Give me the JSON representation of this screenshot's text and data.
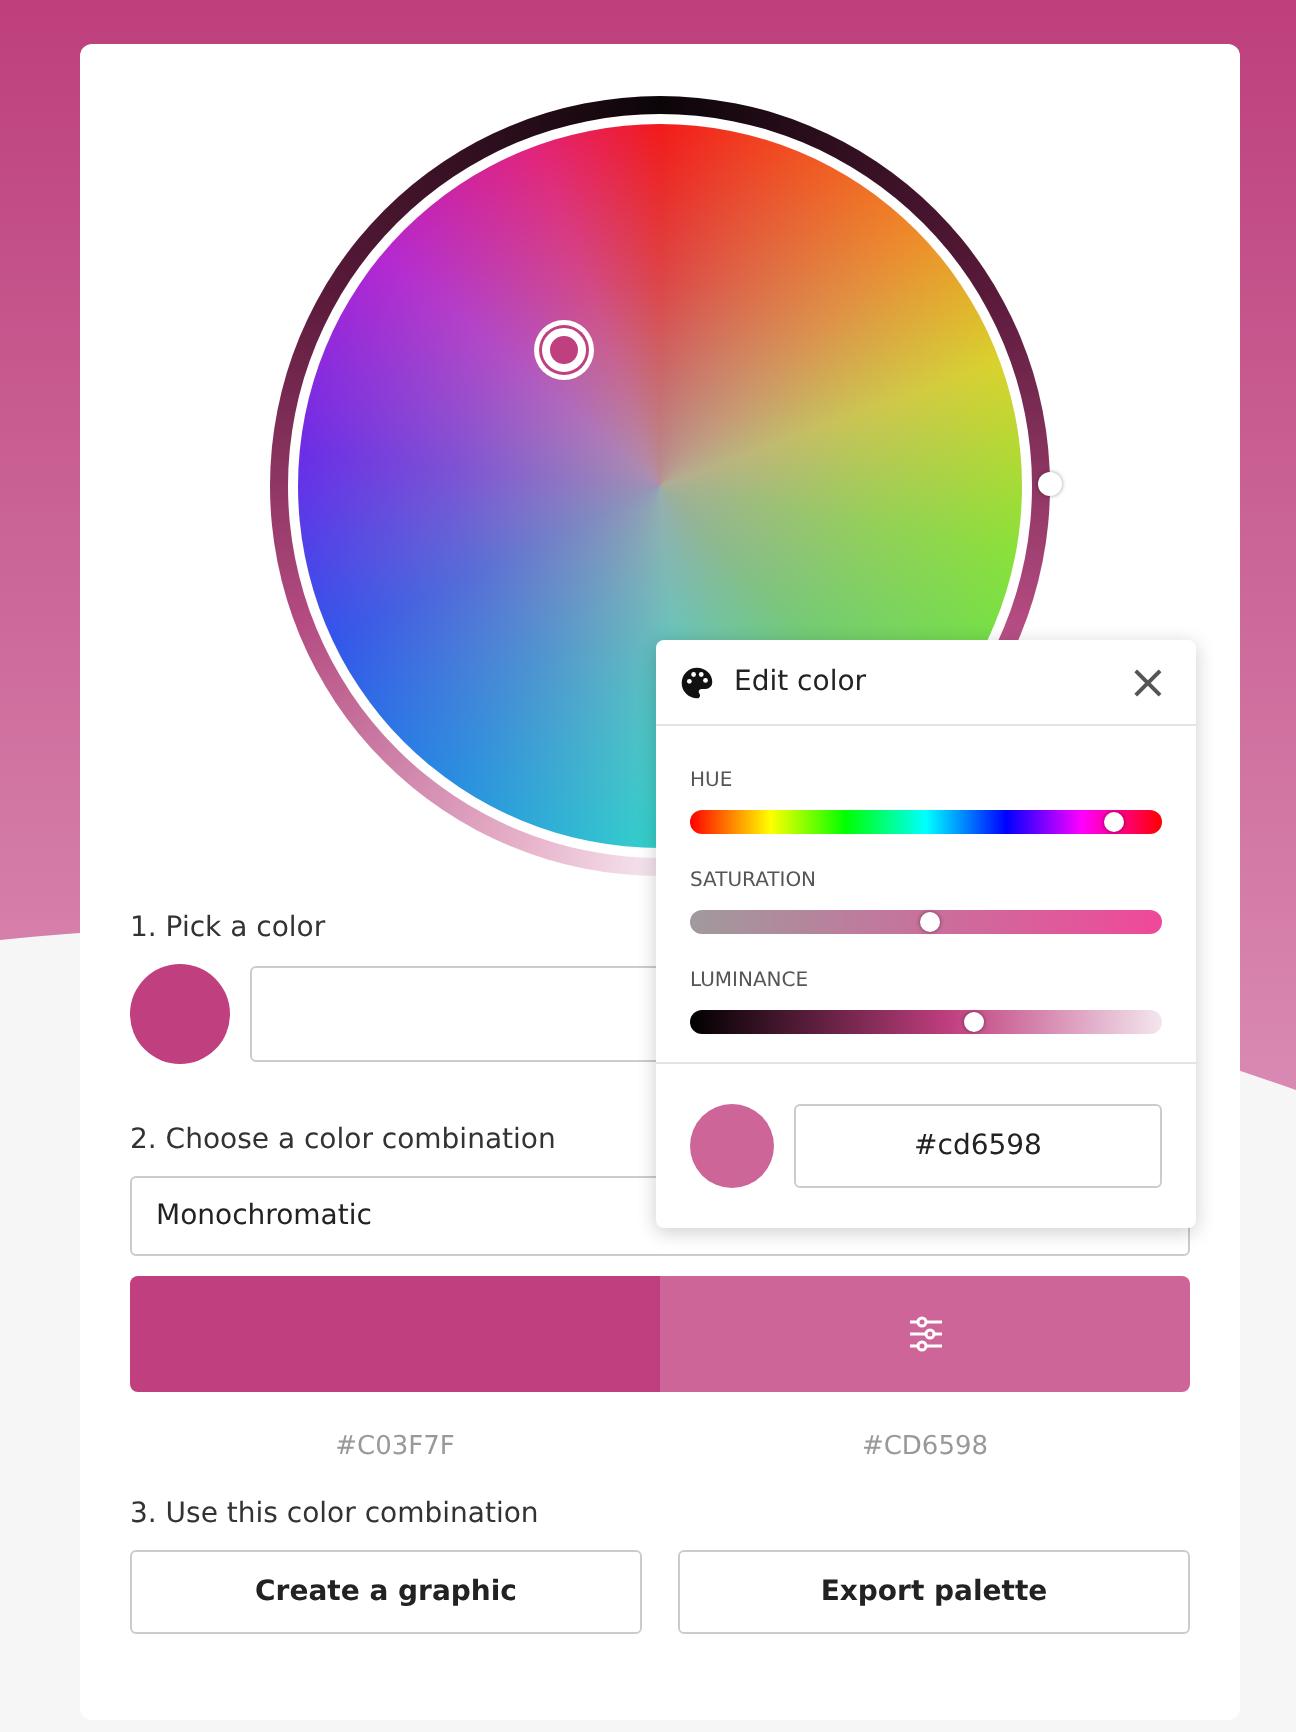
{
  "steps": [
    {
      "label": "1. Pick a color"
    },
    {
      "label": "2. Choose a color combination"
    },
    {
      "label": "3. Use this color combination"
    }
  ],
  "picked": {
    "color": "#c03f7f"
  },
  "combination": {
    "value": "Monochromatic"
  },
  "palette": [
    {
      "color": "#c03f7f",
      "hex": "#C03F7F"
    },
    {
      "color": "#cd6598",
      "hex": "#CD6598"
    }
  ],
  "buttons": [
    "Create a graphic",
    "Export palette"
  ],
  "editor": {
    "title": "Edit color",
    "close": "×",
    "sliders": [
      {
        "label": "HUE",
        "kind": "hue",
        "level": 0.9
      },
      {
        "label": "SATURATION",
        "kind": "saturation",
        "level": 0.51
      },
      {
        "label": "LUMINANCE",
        "kind": "luminance",
        "level": 0.6
      }
    ],
    "color": "#cd6598",
    "hex": "#cd6598"
  }
}
